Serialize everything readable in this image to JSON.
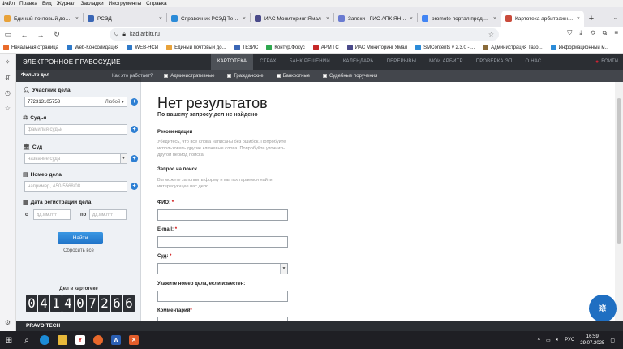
{
  "menubar": [
    "Файл",
    "Правка",
    "Вид",
    "Журнал",
    "Закладки",
    "Инструменты",
    "Справка"
  ],
  "tabs": [
    {
      "title": "Единый почтовый домен",
      "color": "#e8a23a",
      "active": false
    },
    {
      "title": "РСЭД",
      "color": "#3a66b5",
      "active": false
    },
    {
      "title": "Справочник РСЭД Тезис",
      "color": "#2b8bd8",
      "active": false
    },
    {
      "title": "ИАС Мониторинг Ямал",
      "color": "#4a4a8a",
      "active": false
    },
    {
      "title": "Заявки - ГИС АПК ЯНАО",
      "color": "#6a7bd1",
      "active": false
    },
    {
      "title": "promote портал предоста",
      "color": "#4285f4",
      "active": false
    },
    {
      "title": "Картотека арбитражных д",
      "color": "#c94b3b",
      "active": true
    }
  ],
  "tab_close": "×",
  "new_tab": "+",
  "tab_list": "⌄",
  "url": "kad.arbitr.ru",
  "bookmarks": [
    {
      "label": "Начальная страница",
      "color": "#e96b2b"
    },
    {
      "label": "Web-Консолидация",
      "color": "#2f7ac9"
    },
    {
      "label": "WEB-НСИ",
      "color": "#2f7ac9"
    },
    {
      "label": "Единый почтовый до...",
      "color": "#e8a23a"
    },
    {
      "label": "ТЕЗИС",
      "color": "#3a66b5"
    },
    {
      "label": "Контур.Фокус",
      "color": "#2fa84f"
    },
    {
      "label": "АРМ ГС",
      "color": "#c62828"
    },
    {
      "label": "ИАС Мониторинг Ямал",
      "color": "#4a4a8a"
    },
    {
      "label": "SMContents v 2.3.0 - ...",
      "color": "#2b8bd8"
    },
    {
      "label": "Администрация Тазо...",
      "color": "#8a6b3a"
    },
    {
      "label": "Информационный м...",
      "color": "#2b8bd8"
    }
  ],
  "site": {
    "brand": "ЭЛЕКТРОННОЕ ПРАВОСУДИЕ",
    "nav": [
      "КАРТОТЕКА",
      "СТРАХ",
      "БАНК РЕШЕНИЙ",
      "КАЛЕНДАРЬ",
      "ПЕРЕРЫВЫ",
      "МОЙ АРБИТР",
      "ПРОВЕРКА ЭП",
      "О НАС"
    ],
    "exit": "ВОЙТИ"
  },
  "subhdr": {
    "filter": "Фильтр дел",
    "how": "Как это работает?",
    "checks": [
      "Административные",
      "Гражданские",
      "Банкротные",
      "Судебные поручения"
    ]
  },
  "filter": {
    "participant_label": "Участник дела",
    "participant_value": "772313105753",
    "participant_role": "Любой",
    "judge_label": "Судья",
    "judge_placeholder": "фамилия судьи",
    "court_label": "Суд",
    "court_placeholder": "название суда",
    "case_label": "Номер дела",
    "case_placeholder": "например, А50-5568/08",
    "date_label": "Дата регистрации дела",
    "date_from": "с",
    "date_to": "по",
    "date_placeholder": "дд.мм.гггг",
    "find": "Найти",
    "reset": "Сбросить все",
    "counter_label": "Дел в картотеке",
    "counter": [
      "0",
      "4",
      "1",
      "4",
      "0",
      "7",
      "2",
      "6",
      "6"
    ]
  },
  "main": {
    "title": "Нет результатов",
    "subtitle": "По вашему запросу дел не найдено",
    "rec_title": "Рекомендации",
    "rec_text": "Убедитесь, что все слова написаны без ошибок. Попробуйте использовать другие ключевые слова. Попробуйте уточнить другой период поиска.",
    "req_title": "Запрос на поиск",
    "req_text": "Вы можете заполнить форму и мы постараемся найти интересующее вас дело.",
    "fio": "ФИО:",
    "email": "E-mail:",
    "court": "Суд:",
    "case_no": "Укажите номер дела, если известен:",
    "comment": "Комментарий",
    "req_mark": "*"
  },
  "footer": "PRAVO TECH",
  "taskbar": {
    "lang": "РУС",
    "time": "16:59",
    "date": "29.07.2025"
  }
}
